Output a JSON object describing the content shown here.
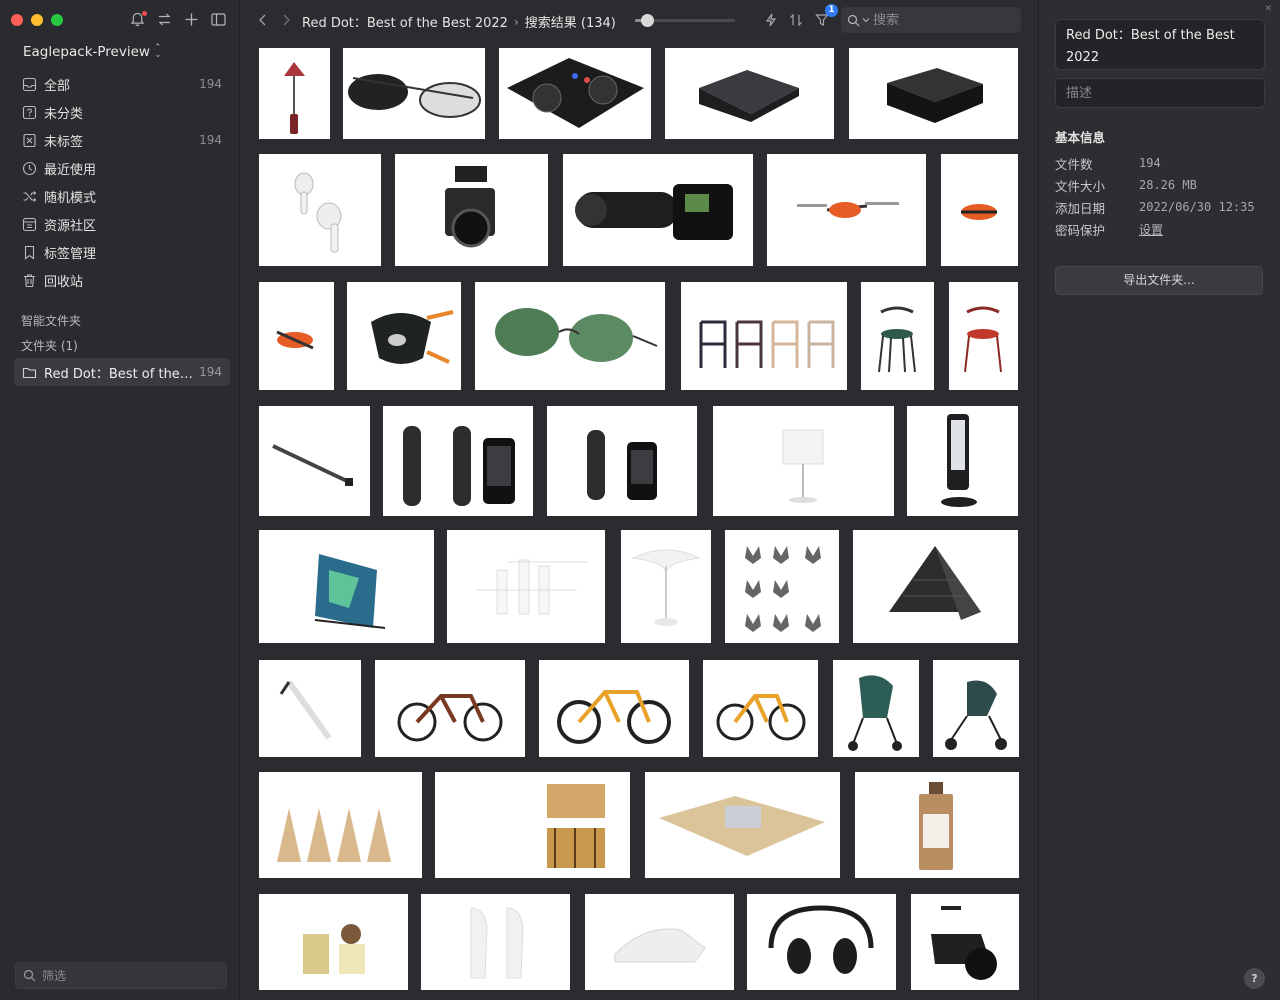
{
  "sidebar": {
    "library_name": "Eaglepack-Preview",
    "library_chevron": "⌃⌄",
    "nav": [
      {
        "label": "全部",
        "count": "194",
        "icon": "inbox-icon"
      },
      {
        "label": "未分类",
        "count": "",
        "icon": "question-box-icon"
      },
      {
        "label": "未标签",
        "count": "194",
        "icon": "tag-off-icon"
      },
      {
        "label": "最近使用",
        "count": "",
        "icon": "clock-icon"
      },
      {
        "label": "随机模式",
        "count": "",
        "icon": "shuffle-icon"
      },
      {
        "label": "资源社区",
        "count": "",
        "icon": "community-icon"
      },
      {
        "label": "标签管理",
        "count": "",
        "icon": "bookmark-icon"
      },
      {
        "label": "回收站",
        "count": "",
        "icon": "trash-icon"
      }
    ],
    "smart_folders_label": "智能文件夹",
    "folders_label": "文件夹 (1)",
    "folder": {
      "label": "Red Dot：Best of the ...",
      "count": "194"
    },
    "filter_placeholder": "筛选"
  },
  "toolbar": {
    "breadcrumb_folder": "Red Dot：Best of the Best 2022",
    "breadcrumb_sep": "›",
    "breadcrumb_current": "搜索结果 (134)",
    "zoom_level": 0.12,
    "filter_badge": "1",
    "search_placeholder": "搜索"
  },
  "inspector": {
    "title": "Red Dot：Best of the Best 2022",
    "description_placeholder": "描述",
    "info_heading": "基本信息",
    "rows": [
      {
        "key": "文件数",
        "value": "194"
      },
      {
        "key": "文件大小",
        "value": "28.26 MB"
      },
      {
        "key": "添加日期",
        "value": "2022/06/30 12:35"
      },
      {
        "key": "密码保护",
        "value": "设置"
      }
    ],
    "export_label": "导出文件夹...",
    "help_label": "?",
    "close_label": "✕"
  },
  "colors": {
    "accent": "#2f7cf6",
    "sidebar_bg": "#2a2b2e",
    "content_bg": "#2b2c2f",
    "selected_bg": "#3a3b3f"
  }
}
